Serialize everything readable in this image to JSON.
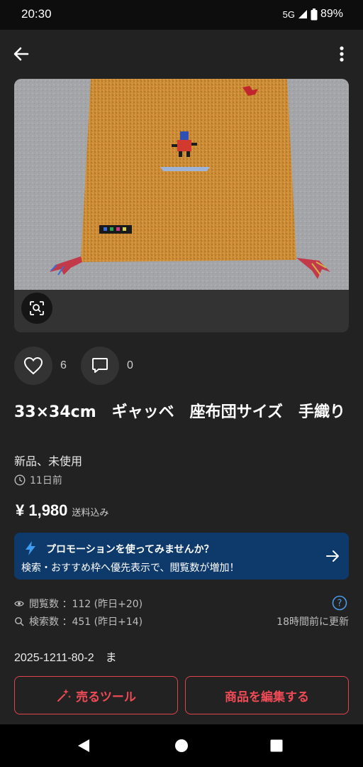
{
  "status_bar": {
    "time": "20:30",
    "network": "5G",
    "battery": "89%"
  },
  "product": {
    "title": "33×34cm　ギャッベ　座布団サイズ　手織り",
    "condition": "新品、未使用",
    "posted": "11日前",
    "price": "¥ 1,980",
    "shipping": "送料込み"
  },
  "reactions": {
    "likes": "6",
    "comments": "0"
  },
  "promo": {
    "title": "プロモーションを使ってみませんか？",
    "subtitle": "検索・おすすめ枠へ優先表示で、閲覧数が増加！"
  },
  "stats": {
    "views": "閲覧数 ：112 (昨日+20)",
    "searches": "検索数 ：451 (昨日+14)",
    "updated": "18時間前に更新"
  },
  "item_code": "2025-1211-80-2　ま",
  "buttons": {
    "sell_tools": "売るツール",
    "edit_item": "商品を編集する"
  },
  "colors": {
    "background": "#222222",
    "card": "#333333",
    "promo": "#0d3a6b",
    "accent_red": "#ef4b56",
    "help_blue": "#4a9be8"
  }
}
